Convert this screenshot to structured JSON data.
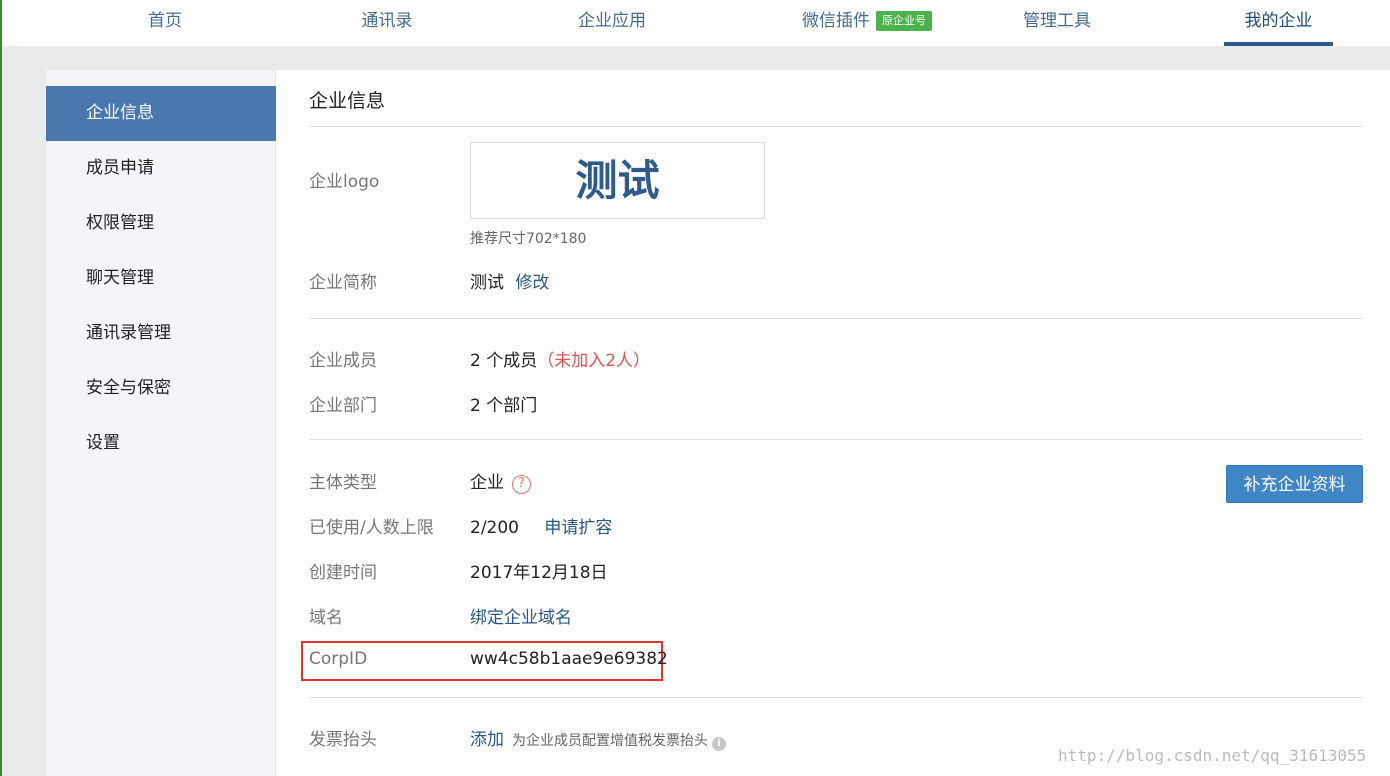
{
  "nav": {
    "items": [
      "首页",
      "通讯录",
      "企业应用",
      "微信插件",
      "管理工具",
      "我的企业"
    ],
    "plugin_badge": "原企业号",
    "active": "我的企业"
  },
  "sidebar": {
    "items": [
      "企业信息",
      "成员申请",
      "权限管理",
      "聊天管理",
      "通讯录管理",
      "安全与保密",
      "设置"
    ],
    "active": "企业信息"
  },
  "main": {
    "title": "企业信息",
    "logo_label": "企业logo",
    "logo_text": "测试",
    "logo_hint": "推荐尺寸702*180",
    "short_name_label": "企业简称",
    "short_name_value": "测试",
    "short_name_edit": "修改",
    "members_label": "企业成员",
    "members_value": "2 个成员",
    "members_pending": "（未加入2人）",
    "departments_label": "企业部门",
    "departments_value": "2 个部门",
    "entity_type_label": "主体类型",
    "entity_type_value": "企业",
    "help_glyph": "?",
    "supplement_button": "补充企业资料",
    "usage_label": "已使用/人数上限",
    "usage_value": "2/200",
    "usage_expand": "申请扩容",
    "created_label": "创建时间",
    "created_value": "2017年12月18日",
    "domain_label": "域名",
    "domain_link": "绑定企业域名",
    "corpid_label": "CorpID",
    "corpid_value": "ww4c58b1aae9e69382",
    "invoice_label": "发票抬头",
    "invoice_add": "添加",
    "invoice_hint": "为企业成员配置增值税发票抬头",
    "info_glyph": "i"
  },
  "watermark": "http://blog.csdn.net/qq_31613055",
  "colors": {
    "accent": "#4a78ae",
    "link": "#2a5886",
    "highlight": "#e0342f",
    "badge": "#4cb24c",
    "button": "#3e86c5"
  }
}
